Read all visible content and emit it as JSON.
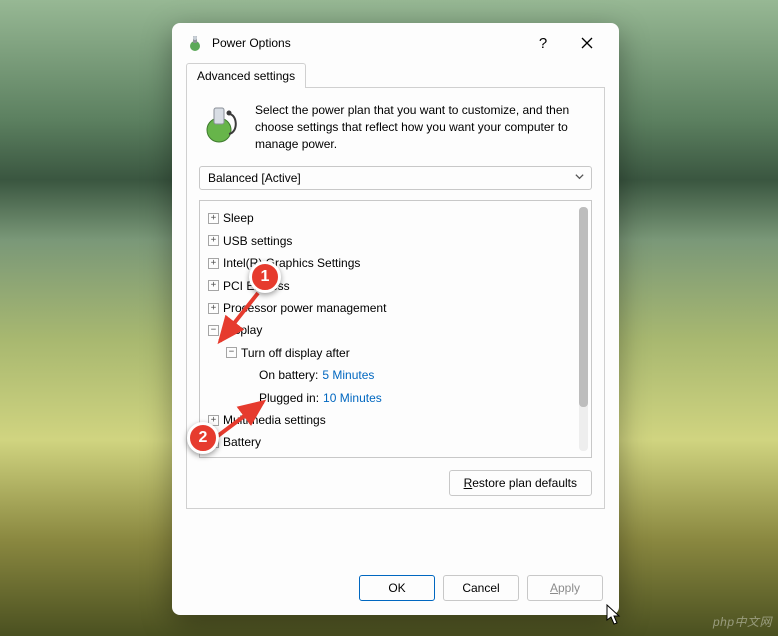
{
  "window": {
    "title": "Power Options",
    "help_tooltip": "?",
    "close_tooltip": "Close"
  },
  "tabs": {
    "active": "Advanced settings"
  },
  "intro": "Select the power plan that you want to customize, and then choose settings that reflect how you want your computer to manage power.",
  "plan_dropdown": {
    "selected": "Balanced [Active]"
  },
  "tree": [
    {
      "expand": "+",
      "label": "Sleep",
      "indent": 0
    },
    {
      "expand": "+",
      "label": "USB settings",
      "indent": 0
    },
    {
      "expand": "+",
      "label": "Intel(R) Graphics Settings",
      "indent": 0
    },
    {
      "expand": "+",
      "label": "PCI Express",
      "indent": 0
    },
    {
      "expand": "+",
      "label": "Processor power management",
      "indent": 0
    },
    {
      "expand": "−",
      "label": "Display",
      "indent": 0
    },
    {
      "expand": "−",
      "label": "Turn off display after",
      "indent": 1
    },
    {
      "expand": "",
      "label": "On battery:",
      "value": "5 Minutes",
      "indent": 2
    },
    {
      "expand": "",
      "label": "Plugged in:",
      "value": "10 Minutes",
      "indent": 2
    },
    {
      "expand": "+",
      "label": "Multimedia settings",
      "indent": 0
    },
    {
      "expand": "+",
      "label": "Battery",
      "indent": 0
    }
  ],
  "buttons": {
    "restore": "Restore plan defaults",
    "ok": "OK",
    "cancel": "Cancel",
    "apply": "Apply"
  },
  "annotations": {
    "marker1": "1",
    "marker2": "2"
  },
  "watermark": "php中文网"
}
